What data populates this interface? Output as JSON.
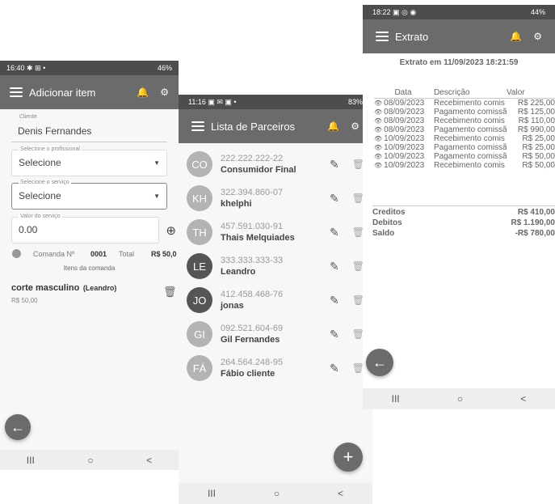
{
  "screen1": {
    "status": {
      "time": "16:40",
      "left_icons": "✱ ⊞ •",
      "right": "46%"
    },
    "title": "Adicionar item",
    "cliente_label": "Cliente",
    "cliente_value": "Denis Fernandes",
    "profissional_label": "Selecione o profissional",
    "profissional_value": "Selecione",
    "servico_label": "Selecione o serviço",
    "servico_value": "Selecione",
    "valor_label": "Valor do serviço",
    "valor_value": "0.00",
    "comanda_label": "Comanda Nº",
    "comanda_value": "0001",
    "total_label": "Total",
    "total_value": "R$ 50,0",
    "itens_label": "Itens da comanda",
    "item_name": "corte masculino",
    "item_prof": "(Leandro)",
    "item_price": "R$ 50,00"
  },
  "screen2": {
    "status": {
      "time": "11:16",
      "left_icons": "▣ ✉ ▣ •",
      "right": "83%"
    },
    "title": "Lista de Parceiros",
    "partners": [
      {
        "initials": "CO",
        "doc": "222.222.222-22",
        "name": "Consumidor Final",
        "color": "#b3b3b3"
      },
      {
        "initials": "KH",
        "doc": "322.394.860-07",
        "name": "khelphi",
        "color": "#b3b3b3"
      },
      {
        "initials": "TH",
        "doc": "457.591.030-91",
        "name": "Thais Melquiades",
        "color": "#b3b3b3"
      },
      {
        "initials": "LE",
        "doc": "333.333.333-33",
        "name": "Leandro",
        "color": "#555555"
      },
      {
        "initials": "JO",
        "doc": "412.458.468-76",
        "name": "jonas",
        "color": "#555555"
      },
      {
        "initials": "GI",
        "doc": "092.521.604-69",
        "name": "Gil Fernandes",
        "color": "#b3b3b3"
      },
      {
        "initials": "FÁ",
        "doc": "264.564.248-95",
        "name": "Fábio cliente",
        "color": "#b3b3b3"
      }
    ]
  },
  "screen3": {
    "status": {
      "time": "18:22",
      "left_icons": "▣ ◎ ◉",
      "right": "44%"
    },
    "title": "Extrato",
    "heading": "Extrato em 11/09/2023 18:21:59",
    "columns": [
      "Data",
      "Descrição",
      "Valor"
    ],
    "rows": [
      {
        "date": "08/09/2023",
        "desc": "Recebimento comis",
        "value": "R$ 225,00"
      },
      {
        "date": "08/09/2023",
        "desc": "Pagamento comissã",
        "value": "R$ 125,00"
      },
      {
        "date": "08/09/2023",
        "desc": "Recebimento comis",
        "value": "R$ 110,00"
      },
      {
        "date": "08/09/2023",
        "desc": "Pagamento comissã",
        "value": "R$ 990,00"
      },
      {
        "date": "10/09/2023",
        "desc": "Recebimento comis",
        "value": "R$ 25,00"
      },
      {
        "date": "10/09/2023",
        "desc": "Pagamento comissã",
        "value": "R$ 25,00"
      },
      {
        "date": "10/09/2023",
        "desc": "Pagamento comissã",
        "value": "R$ 50,00"
      },
      {
        "date": "10/09/2023",
        "desc": "Recebimento comis",
        "value": "R$ 50,00"
      }
    ],
    "creditos_label": "Creditos",
    "creditos_value": "R$ 410,00",
    "debitos_label": "Debitos",
    "debitos_value": "R$ 1.190,00",
    "saldo_label": "Saldo",
    "saldo_value": "-R$ 780,00"
  },
  "icons": {
    "bell": "🔔",
    "gear": "⚙",
    "eye": "👁",
    "edit": "✎",
    "trash": "🗑",
    "back": "←",
    "plus": "+",
    "add_circle": "⊕"
  },
  "nav": {
    "recent": "III",
    "home": "○",
    "back": "<"
  }
}
